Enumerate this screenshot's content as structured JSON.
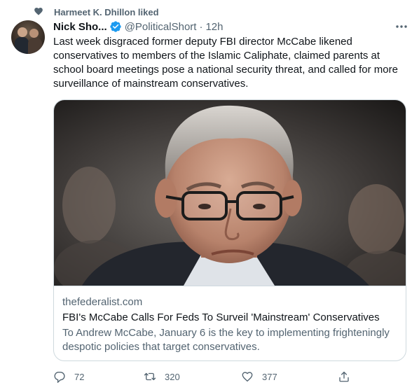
{
  "social_context": {
    "text": "Harmeet K. Dhillon liked",
    "icon": "heart-icon"
  },
  "tweet": {
    "author_name": "Nick Sho...",
    "handle": "@PoliticalShort",
    "separator": "·",
    "time": "12h",
    "verified": true,
    "text": "Last week disgraced former deputy FBI director McCabe likened conservatives to members of the Islamic Caliphate, claimed parents at school board meetings pose a national security threat, and called for more surveillance of mainstream conservatives."
  },
  "card": {
    "domain": "thefederalist.com",
    "title": "FBI's McCabe Calls For Feds To Surveil 'Mainstream' Conservatives",
    "description": "To Andrew McCabe, January 6 is the key to implementing frighteningly despotic policies that target conservatives."
  },
  "actions": {
    "reply_count": "72",
    "retweet_count": "320",
    "like_count": "377"
  },
  "colors": {
    "text_primary": "#0f1419",
    "text_secondary": "#536471",
    "verified_blue": "#1d9bf0",
    "border": "#cfd9de"
  }
}
